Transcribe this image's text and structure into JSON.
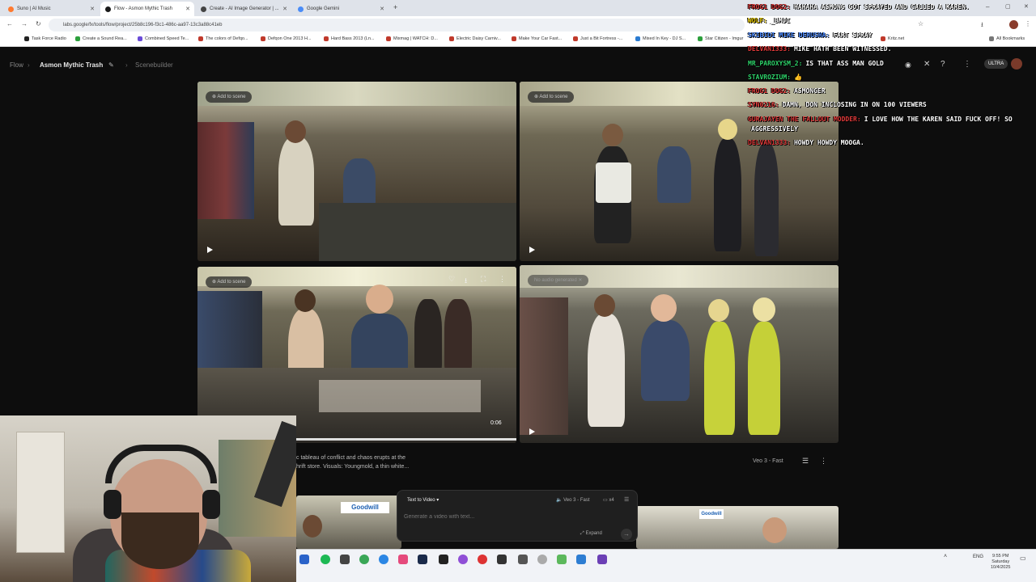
{
  "browser": {
    "tabs": [
      {
        "title": "Suno | AI Music",
        "color": "#ff7a2f"
      },
      {
        "title": "Flow - Asmon Mythic Trash",
        "color": "#1a1a1a"
      },
      {
        "title": "Create - AI Image Generator | ...",
        "color": "#444"
      },
      {
        "title": "Google Gemini",
        "color": "#4a8cf7"
      }
    ],
    "url": "labs.google/fx/tools/flow/project/25b8c196-f3c1-486c-aa97-13c3a88c41eb",
    "bookmarks": [
      {
        "label": "Task Force Radio",
        "color": "#222"
      },
      {
        "label": "Create a Sound Rea...",
        "color": "#2c9f3c"
      },
      {
        "label": "Combined Speed Te...",
        "color": "#6a4bd8"
      },
      {
        "label": "The colors of Defqo...",
        "color": "#c0392b"
      },
      {
        "label": "Defqon One 2013 H...",
        "color": "#c0392b"
      },
      {
        "label": "Hard Bass 2013 (Ln...",
        "color": "#c0392b"
      },
      {
        "label": "Mixmag | WATCH: D...",
        "color": "#c0392b"
      },
      {
        "label": "Electric Daisy Carniv...",
        "color": "#c0392b"
      },
      {
        "label": "Make Your Car Fast...",
        "color": "#c0392b"
      },
      {
        "label": "Just a Bit Fortress -...",
        "color": "#c0392b"
      },
      {
        "label": "Mixed In Key - DJ S...",
        "color": "#2a7bd1"
      },
      {
        "label": "Star Citizen - Imgur",
        "color": "#2c9f3c"
      },
      {
        "label": "Kritz.net",
        "color": "#c0392b"
      },
      {
        "label": "All Bookmarks",
        "color": "#777"
      }
    ]
  },
  "app": {
    "breadcrumb_root": "Flow",
    "project_name": "Asmon Mythic Trash",
    "breadcrumb_current": "Scenebuilder",
    "plan_badge": "ULTRA",
    "add_to_scene_label": "Add to scene",
    "no_audio_label": "No audio generated",
    "clip_time": "0:06",
    "prompt_text_line1": "c tableau of conflict and chaos erupts at the",
    "prompt_text_line2": "hrift store. Visuals: Youngmold, a thin white...",
    "model_label": "Veo 3 - Fast",
    "composer": {
      "mode": "Text to Video",
      "placeholder": "Generate a video with text...",
      "model": "Veo 3 - Fast",
      "count": "x4",
      "expand": "Expand"
    },
    "store_sign": "Goodwill"
  },
  "chat": [
    {
      "user": "FROG1 DOG2:",
      "user_color": "#e23a3a",
      "text": "HAHAHA ASMONG GOT SPRAYED AND CALLED A KAREN."
    },
    {
      "user": "WOLF:",
      "user_color": "#f0d000",
      "text": "_BMJI"
    },
    {
      "user": "SKIBIDI MIKE DERUSHA:",
      "user_color": "#4d8bff",
      "text": "FART SPRAY"
    },
    {
      "user": "DELVAN1333:",
      "user_color": "#e23a3a",
      "text": "MIKE HATH BEEN WITNESSED."
    },
    {
      "user": "MR_PAROXYSM_2:",
      "user_color": "#2ed36a",
      "text": "IS THAT ASS MAN GOLD"
    },
    {
      "user": "STAVROZIUM:",
      "user_color": "#2ed36a",
      "text": "👍"
    },
    {
      "user": "FROG1 DOG2:",
      "user_color": "#e23a3a",
      "text": "ASMONGER"
    },
    {
      "user": "SYN0216:",
      "user_color": "#e23a3a",
      "text": "DAMN, DON INCLOSING IN ON 100 VIEWERS"
    },
    {
      "user": "GURAJAYEN THE FALLOUT MODDER:",
      "user_color": "#e23a3a",
      "text": "I LOVE HOW THE KAREN SAID FUCK OFF! SO"
    },
    {
      "user": "",
      "user_color": "#e23a3a",
      "text": "AGGRESSIVELY"
    },
    {
      "user": "DELVAN1333:",
      "user_color": "#e23a3a",
      "text": "HOWDY HOWDY MOOGA."
    }
  ],
  "taskbar": {
    "language": "ENG",
    "time": "9:55 PM",
    "day": "Saturday",
    "date": "10/4/2025"
  }
}
